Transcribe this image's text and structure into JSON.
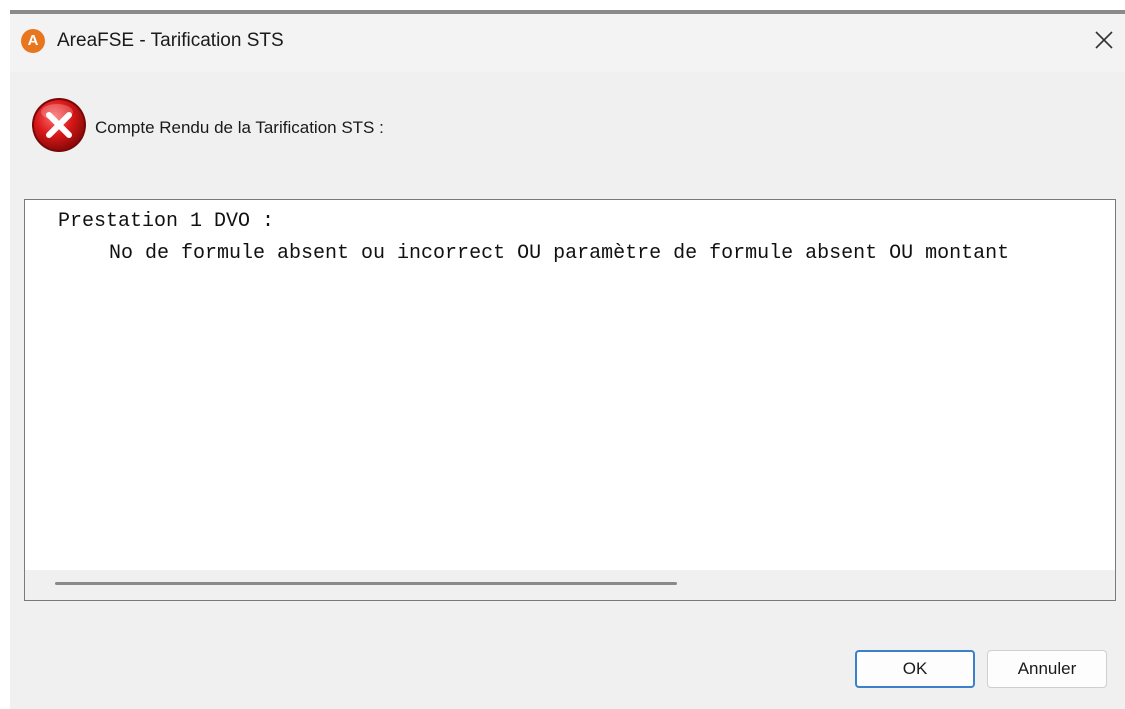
{
  "window": {
    "title": "AreaFSE - Tarification STS",
    "app_icon_letter": "A",
    "accent_color": "#e8761f"
  },
  "dialog": {
    "header_message": "Compte Rendu de la Tarification STS :",
    "icon": "error-icon",
    "report_lines": [
      "Prestation 1 DVO :",
      "  No de formule absent ou incorrect OU paramètre de formule absent OU montant"
    ]
  },
  "buttons": {
    "ok_label": "OK",
    "cancel_label": "Annuler",
    "focus_color": "#3c80c9"
  }
}
